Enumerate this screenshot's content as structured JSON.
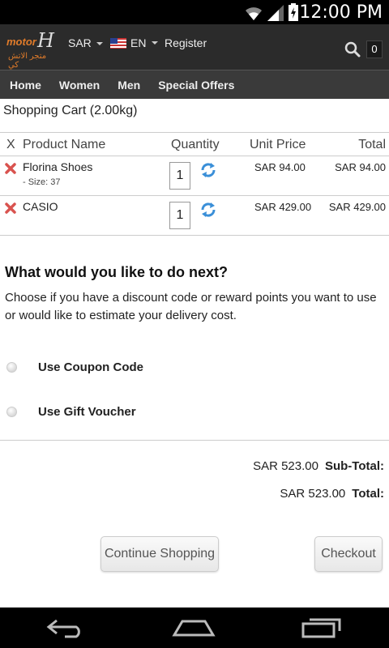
{
  "status_bar": {
    "time": "12:00 PM"
  },
  "header": {
    "logo": {
      "line1": "motor",
      "line2": "H",
      "line3": "متجر الاتش كي"
    },
    "currency": "SAR",
    "language": "EN",
    "register_label": "Register",
    "cart_count": "0"
  },
  "nav": {
    "items": [
      {
        "label": "Home"
      },
      {
        "label": "Women"
      },
      {
        "label": "Men"
      },
      {
        "label": "Special Offers"
      }
    ]
  },
  "cart": {
    "title": "Shopping Cart  (2.00kg)",
    "columns": {
      "remove": "X",
      "product_name": "Product Name",
      "quantity": "Quantity",
      "unit_price": "Unit Price",
      "total": "Total"
    },
    "items": [
      {
        "name": "Florina Shoes",
        "option": "- Size: 37",
        "quantity": "1",
        "unit_price": "SAR 94.00",
        "total": "SAR 94.00"
      },
      {
        "name": "CASIO",
        "option": "",
        "quantity": "1",
        "unit_price": "SAR 429.00",
        "total": "SAR 429.00"
      }
    ]
  },
  "next": {
    "title": "What would you like to do next?",
    "description": "Choose if you have a discount code or reward points you want to use or would like to estimate your delivery cost.",
    "options": [
      {
        "label": "Use Coupon Code"
      },
      {
        "label": "Use Gift Voucher"
      }
    ]
  },
  "totals": {
    "subtotal_value": "SAR 523.00",
    "subtotal_label": "Sub-Total:",
    "total_value": "SAR 523.00",
    "total_label": "Total:"
  },
  "buttons": {
    "continue_label": "Continue Shopping",
    "checkout_label": "Checkout"
  },
  "colors": {
    "header_bg": "#2b2b2b",
    "nav_bg": "#3a3a3a",
    "remove_icon": "#d9534f",
    "refresh_icon": "#3a8fd8",
    "logo_accent": "#e07b2a"
  }
}
